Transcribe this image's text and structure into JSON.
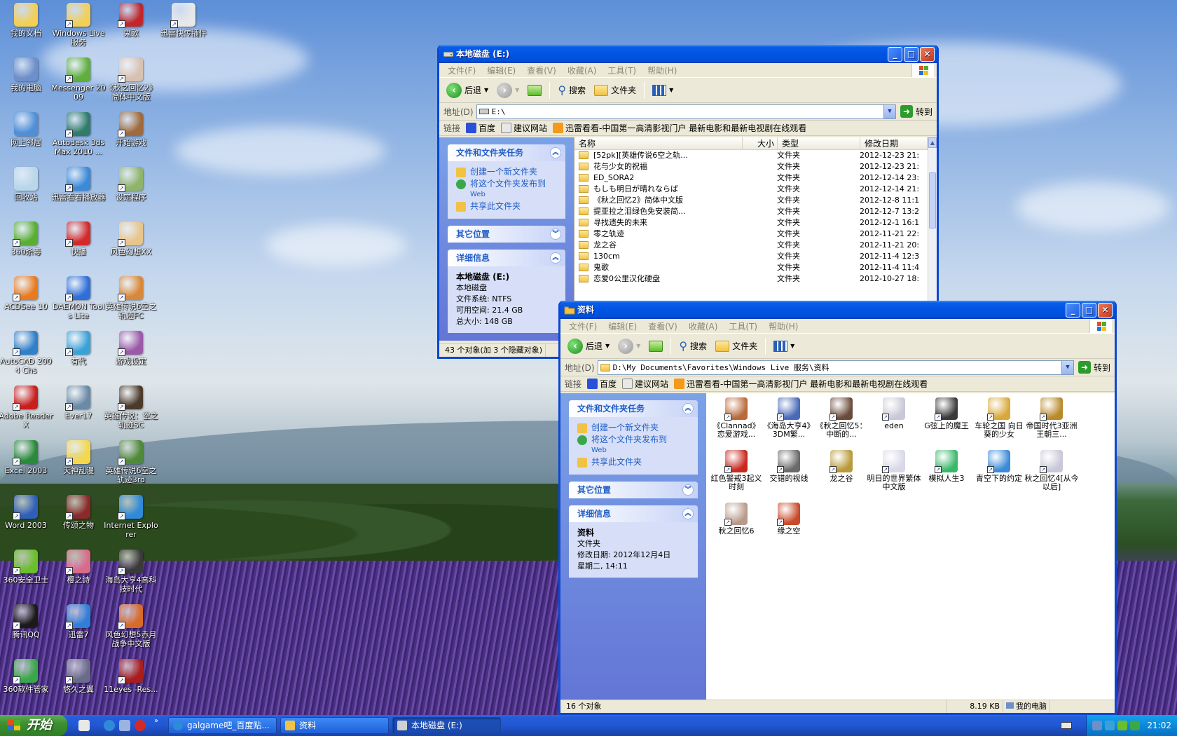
{
  "desktop": {
    "icons": [
      {
        "label": "我的文档",
        "color": "#f3cf55"
      },
      {
        "label": "Windows Live 服务",
        "color": "#f3cf55"
      },
      {
        "label": "鬼歌",
        "color": "#c0272d"
      },
      {
        "label": "迅雷快传插件",
        "color": "#e8e8e8"
      },
      {
        "label": "我的电脑",
        "color": "#6e8fc9"
      },
      {
        "label": "Messenger 2009",
        "color": "#5fae3e"
      },
      {
        "label": "《秋之回忆2》简体中文版",
        "color": "#d7c2b1"
      },
      {
        "label": "网上邻居",
        "color": "#4f8fd8"
      },
      {
        "label": "Autodesk 3ds Max 2010 ...",
        "color": "#2f7c6a"
      },
      {
        "label": "开始游戏",
        "color": "#a06a3c"
      },
      {
        "label": "回收站",
        "color": "#b9d7ea"
      },
      {
        "label": "迅雷看看播放器",
        "color": "#3a8ad8"
      },
      {
        "label": "设定程序",
        "color": "#8fb469"
      },
      {
        "label": "360杀毒",
        "color": "#5aae33"
      },
      {
        "label": "快播",
        "color": "#d22a2a"
      },
      {
        "label": "风色幻想XX",
        "color": "#e8c58a"
      },
      {
        "label": "ACDSee 10",
        "color": "#e87a1f"
      },
      {
        "label": "DAEMON Tools Lite",
        "color": "#2f6fd8"
      },
      {
        "label": "英雄传说6空之轨迹FC",
        "color": "#d8883a"
      },
      {
        "label": "AutoCAD 2004 Chs",
        "color": "#2f7fc9"
      },
      {
        "label": "有代",
        "color": "#3aa1d8"
      },
      {
        "label": "游戏设定",
        "color": "#9a5aa8"
      },
      {
        "label": "Adobe Reader X",
        "color": "#c81e1e"
      },
      {
        "label": "Ever17",
        "color": "#6a8aa8"
      },
      {
        "label": "英雄传说：空之轨迹SC",
        "color": "#4a3a2a"
      },
      {
        "label": "Excel 2003",
        "color": "#2a8a3a"
      },
      {
        "label": "天神乱漫",
        "color": "#f3d84a"
      },
      {
        "label": "英雄传说6空之轨迹3rd",
        "color": "#4f8a3a"
      },
      {
        "label": "Word 2003",
        "color": "#2f5fb8"
      },
      {
        "label": "传颂之物",
        "color": "#8a2a2a"
      },
      {
        "label": "Internet Explorer",
        "color": "#2f8ad8"
      },
      {
        "label": "360安全卫士",
        "color": "#6abf2a"
      },
      {
        "label": "樱之诗",
        "color": "#d86a8a"
      },
      {
        "label": "海岛大亨4高科技时代",
        "color": "#3a3a3a"
      },
      {
        "label": "腾讯QQ",
        "color": "#1a1a1a"
      },
      {
        "label": "迅雷7",
        "color": "#2f7fd8"
      },
      {
        "label": "风色幻想5赤月战争中文版",
        "color": "#d86a2a"
      },
      {
        "label": "360软件管家",
        "color": "#3aa84a"
      },
      {
        "label": "悠久之翼",
        "color": "#6a6a8a"
      },
      {
        "label": "11eyes -Res...",
        "color": "#a81e1e"
      }
    ]
  },
  "window_e": {
    "title": "本地磁盘 (E:)",
    "menu": [
      "文件(F)",
      "编辑(E)",
      "查看(V)",
      "收藏(A)",
      "工具(T)",
      "帮助(H)"
    ],
    "toolbar": {
      "back": "后退",
      "search": "搜索",
      "folders": "文件夹"
    },
    "address_label": "地址(D)",
    "address": "E:\\",
    "goto": "转到",
    "links_label": "链接",
    "links": [
      "百度",
      "建议网站",
      "迅雷看看-中国第一高清影视门户  最新电影和最新电视剧在线观看"
    ],
    "tasks": {
      "header": "文件和文件夹任务",
      "items": [
        "创建一个新文件夹",
        "将这个文件夹发布到",
        "共享此文件夹"
      ],
      "web": "Web"
    },
    "other_places": "其它位置",
    "details": {
      "header": "详细信息",
      "name": "本地磁盘 (E:)",
      "type": "本地磁盘",
      "fs": "文件系统: NTFS",
      "free": "可用空间: 21.4 GB",
      "total": "总大小: 148 GB"
    },
    "columns": [
      "名称",
      "大小",
      "类型",
      "修改日期"
    ],
    "rows": [
      {
        "name": "[52pk][英雄传说6空之轨...",
        "type": "文件夹",
        "date": "2012-12-23 21:"
      },
      {
        "name": "花与少女的祝福",
        "type": "文件夹",
        "date": "2012-12-23 21:"
      },
      {
        "name": "ED_SORA2",
        "type": "文件夹",
        "date": "2012-12-14 23:"
      },
      {
        "name": "もしも明日が晴れならば",
        "type": "文件夹",
        "date": "2012-12-14 21:"
      },
      {
        "name": "《秋之回忆2》简体中文版",
        "type": "文件夹",
        "date": "2012-12-8 11:1"
      },
      {
        "name": "提亚拉之泪绿色免安装简...",
        "type": "文件夹",
        "date": "2012-12-7 13:2"
      },
      {
        "name": "寻找遗失的未来",
        "type": "文件夹",
        "date": "2012-12-1 16:1"
      },
      {
        "name": "零之轨迹",
        "type": "文件夹",
        "date": "2012-11-21 22:"
      },
      {
        "name": "龙之谷",
        "type": "文件夹",
        "date": "2012-11-21 20:"
      },
      {
        "name": "130cm",
        "type": "文件夹",
        "date": "2012-11-4 12:3"
      },
      {
        "name": "鬼歌",
        "type": "文件夹",
        "date": "2012-11-4 11:4"
      },
      {
        "name": "恋爱0公里汉化硬盘",
        "type": "文件夹",
        "date": "2012-10-27 18:"
      }
    ],
    "status": "43 个对象(加 3 个隐藏对象)"
  },
  "window_z": {
    "title": "资料",
    "menu": [
      "文件(F)",
      "编辑(E)",
      "查看(V)",
      "收藏(A)",
      "工具(T)",
      "帮助(H)"
    ],
    "toolbar": {
      "back": "后退",
      "search": "搜索",
      "folders": "文件夹"
    },
    "address_label": "地址(D)",
    "address": "D:\\My Documents\\Favorites\\Windows Live 服务\\资料",
    "goto": "转到",
    "links_label": "链接",
    "links": [
      "百度",
      "建议网站",
      "迅雷看看-中国第一高清影视门户  最新电影和最新电视剧在线观看"
    ],
    "tasks": {
      "header": "文件和文件夹任务",
      "items": [
        "创建一个新文件夹",
        "将这个文件夹发布到",
        "共享此文件夹"
      ],
      "web": "Web"
    },
    "other_places": "其它位置",
    "details": {
      "header": "详细信息",
      "name": "资料",
      "type": "文件夹",
      "modified": "修改日期: 2012年12月4日",
      "weekday": "星期二, 14:11"
    },
    "items": [
      {
        "label": "《Clannad》恋爱游戏...",
        "color": "#b86a3a"
      },
      {
        "label": "《海岛大亨4》3DM繁...",
        "color": "#4a6ab8"
      },
      {
        "label": "《秋之回忆5：中断的...",
        "color": "#6a4a3a"
      },
      {
        "label": "eden",
        "color": "#c8c8d8"
      },
      {
        "label": "G弦上的魔王",
        "color": "#3a3a3a"
      },
      {
        "label": "车轮之国 向日葵的少女",
        "color": "#d8a83a"
      },
      {
        "label": "帝国时代3亚洲王朝三...",
        "color": "#b88a2a"
      },
      {
        "label": "红色警戒3起义时刻",
        "color": "#c8281e"
      },
      {
        "label": "交错的视线",
        "color": "#6a6a6a"
      },
      {
        "label": "龙之谷",
        "color": "#b89a3a"
      },
      {
        "label": "明日的世界繁体中文版",
        "color": "#d8d8e8"
      },
      {
        "label": "模拟人生3",
        "color": "#3ab86a"
      },
      {
        "label": "青空下的约定",
        "color": "#3a8ad8"
      },
      {
        "label": "秋之回忆4[从今以后]",
        "color": "#c8c8d8"
      },
      {
        "label": "秋之回忆6",
        "color": "#b89a8a"
      },
      {
        "label": "缘之空",
        "color": "#c84a2a"
      }
    ],
    "status_count": "16 个对象",
    "status_size": "8.19 KB",
    "status_location": "我的电脑"
  },
  "taskbar": {
    "start": "开始",
    "tasks": [
      "galgame吧_百度贴...",
      "资料",
      "本地磁盘 (E:)"
    ],
    "clock": "21:02"
  }
}
